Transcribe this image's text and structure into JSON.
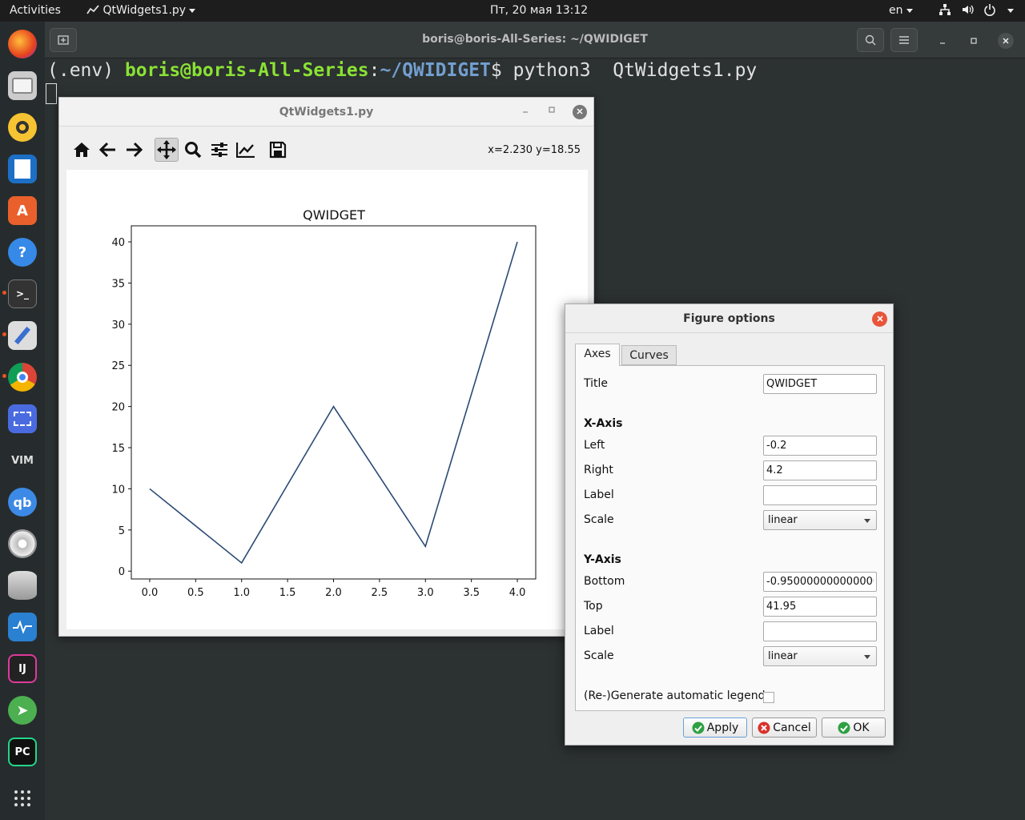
{
  "topbar": {
    "activities": "Activities",
    "app_menu": "QtWidgets1.py",
    "clock": "Пт, 20 мая  13:12",
    "lang": "en"
  },
  "terminal": {
    "title": "boris@boris-All-Series: ~/QWIDIGET",
    "prompt_env": "(.env) ",
    "prompt_user": "boris@boris-All-Series",
    "prompt_colon": ":",
    "prompt_path": "~/QWIDIGET",
    "prompt_dollar": "$ ",
    "command": "python3  QtWidgets1.py"
  },
  "plot_window": {
    "title": "QtWidgets1.py",
    "coords": "x=2.230 y=18.55"
  },
  "chart_data": {
    "type": "line",
    "title": "QWIDGET",
    "xlabel": "",
    "ylabel": "",
    "x": [
      0,
      1,
      2,
      3,
      4
    ],
    "series": [
      {
        "values": [
          10,
          1,
          20,
          3,
          40
        ],
        "color": "#2a4a74"
      }
    ],
    "xlim": [
      -0.2,
      4.2
    ],
    "ylim": [
      -0.95,
      41.95
    ],
    "xticks": [
      "0.0",
      "0.5",
      "1.0",
      "1.5",
      "2.0",
      "2.5",
      "3.0",
      "3.5",
      "4.0"
    ],
    "yticks": [
      "0",
      "5",
      "10",
      "15",
      "20",
      "25",
      "30",
      "35",
      "40"
    ],
    "grid": false
  },
  "dialog": {
    "title": "Figure options",
    "tabs": [
      "Axes",
      "Curves"
    ],
    "title_label": "Title",
    "title_value": "QWIDGET",
    "xaxis_header": "X-Axis",
    "left_label": "Left",
    "left_value": "-0.2",
    "right_label": "Right",
    "right_value": "4.2",
    "xlabel_label": "Label",
    "xlabel_value": "",
    "xscale_label": "Scale",
    "xscale_value": "linear",
    "yaxis_header": "Y-Axis",
    "bottom_label": "Bottom",
    "bottom_value": "-0.9500000000000001",
    "top_label": "Top",
    "top_value": "41.95",
    "ylabel_label": "Label",
    "ylabel_value": "",
    "yscale_label": "Scale",
    "yscale_value": "linear",
    "legend_label": "(Re-)Generate automatic legend",
    "apply": "Apply",
    "cancel": "Cancel",
    "ok": "OK"
  },
  "icons": {
    "home": "home-icon",
    "back": "arrow-left-icon",
    "forward": "arrow-right-icon",
    "pan": "move-icon",
    "zoom": "magnifier-icon",
    "subplots": "sliders-icon",
    "customize": "chart-edit-icon",
    "save": "floppy-icon"
  },
  "colors": {
    "line": "#2a4a74",
    "dialog_close": "#e8553a",
    "prompt_user": "#8ae234",
    "prompt_path": "#729fcf"
  }
}
